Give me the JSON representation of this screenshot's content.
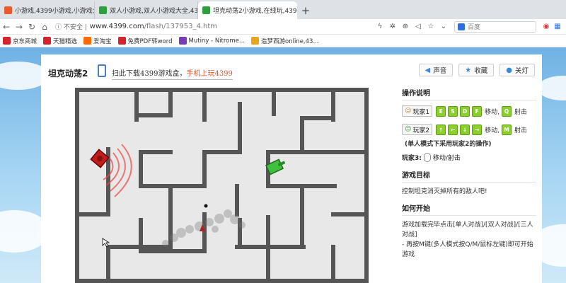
{
  "tabs": [
    {
      "title": "小游戏,4399小游戏,小游戏大全,双人",
      "fav": "#e85b2a",
      "active": false
    },
    {
      "title": "双人小游戏,双人小游戏大全,4399双",
      "fav": "#2f9e3f",
      "active": false
    },
    {
      "title": "坦克动荡2小游戏,在线玩,4399小",
      "fav": "#2f9e3f",
      "active": true
    }
  ],
  "address": {
    "security": "不安全",
    "host": "www.4399.com",
    "path": "/flash/137953_4.htm",
    "search_placeholder": "百度"
  },
  "bookmarks": [
    {
      "label": "京东商城",
      "color": "#d3232c"
    },
    {
      "label": "天猫精选",
      "color": "#d3232c"
    },
    {
      "label": "爱淘宝",
      "color": "#ff6b00"
    },
    {
      "label": "免费PDF转word",
      "color": "#d3232c"
    },
    {
      "label": "Mutiny - Nitrome...",
      "color": "#7a3bb8"
    },
    {
      "label": "造梦西游online,43...",
      "color": "#e9a51c"
    }
  ],
  "game": {
    "title": "坦克动荡2",
    "promo_prefix": "扫此下载4399游戏盒，",
    "promo_highlight": "手机上玩4399",
    "buttons": [
      {
        "label": "声音",
        "icon": "speaker-icon",
        "glyph": "◀"
      },
      {
        "label": "收藏",
        "icon": "star-icon",
        "glyph": "★"
      },
      {
        "label": "关灯",
        "icon": "bulb-icon",
        "glyph": "●"
      }
    ]
  },
  "instructions": {
    "heading": "操作说明",
    "player1": {
      "label": "玩家1",
      "keys": [
        "E",
        "S",
        "D",
        "F"
      ],
      "move": "移动,",
      "fire_key": "Q",
      "fire": "射击"
    },
    "player2": {
      "label": "玩家2",
      "keys": [
        "↑",
        "←",
        "↓",
        "→"
      ],
      "move": "移动,",
      "fire_key": "M",
      "fire": "射击"
    },
    "note": "(单人模式下采用玩家2的操作)",
    "player3_label": "玩家3:",
    "player3_text": "移动/射击",
    "goal_heading": "游戏目标",
    "goal_text": "控制坦克消灭掉所有的敌人吧!",
    "start_heading": "如何开始",
    "start_line1": "游戏加载完毕点击[单人对战]/[双人对战]/[三人对战]",
    "start_line2": "- 再按M键(多人模式按Q/M/鼠标左键)即可开始游戏"
  }
}
